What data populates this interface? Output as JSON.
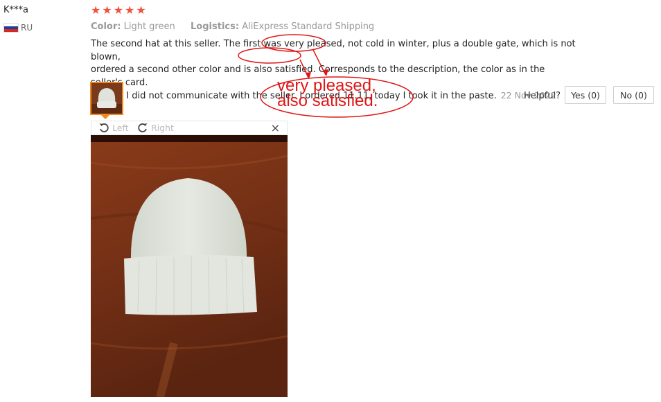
{
  "reviewer": {
    "name": "K***a",
    "country": "RU"
  },
  "rating": {
    "stars": 5,
    "max": 5
  },
  "meta": {
    "color_label": "Color:",
    "color_value": "Light green",
    "logistics_label": "Logistics:",
    "logistics_value": "AliExpress Standard Shipping"
  },
  "review": {
    "line1": "The second hat at this seller. The first was very pleased, not cold in winter, plus a double gate, which is not blown,",
    "line2": "ordered a second other color and is also satisfied. Corresponds to the description, the color as in the seller's card.",
    "line3": "Advise. I did not communicate with the seller. I ordered 11.11, today I took it in the paste.",
    "date": "22 Nov 2022 09:48"
  },
  "viewer": {
    "rotate_left": "Left",
    "rotate_right": "Right",
    "close": "×"
  },
  "helpful": {
    "label": "Helpful?",
    "yes": "Yes (0)",
    "no": "No (0)"
  },
  "annotation": {
    "line1": "very pleased,",
    "line2": "also satisfied."
  },
  "colors": {
    "star": "#f0523d",
    "thumb_border": "#f08a1f",
    "annotation": "#e01616"
  }
}
